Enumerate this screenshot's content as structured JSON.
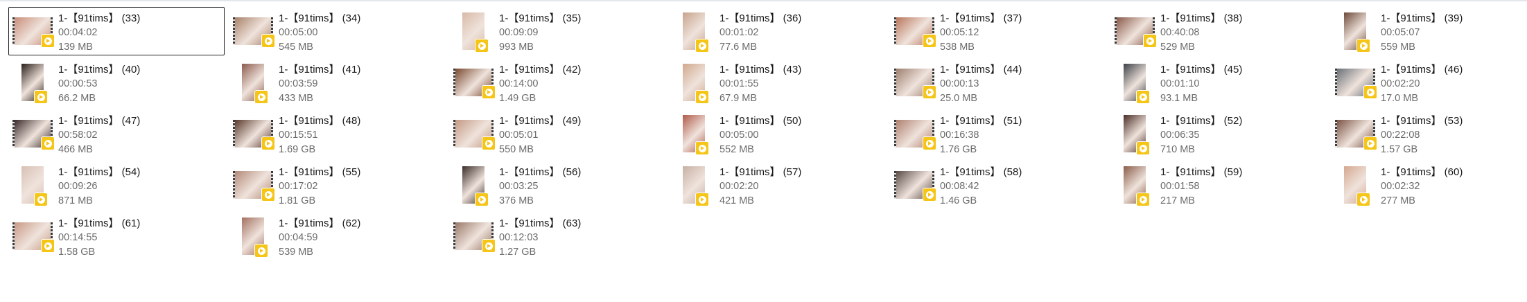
{
  "files": [
    {
      "name": "1-【91tims】 (33)",
      "duration": "00:04:02",
      "size": "139 MB",
      "orientation": "landscape",
      "selected": true,
      "tone": "#c98e7a"
    },
    {
      "name": "1-【91tims】 (34)",
      "duration": "00:05:00",
      "size": "545 MB",
      "orientation": "landscape",
      "selected": false,
      "tone": "#a9826a"
    },
    {
      "name": "1-【91tims】 (35)",
      "duration": "00:09:09",
      "size": "993 MB",
      "orientation": "portrait",
      "selected": false,
      "tone": "#d9b9a6"
    },
    {
      "name": "1-【91tims】 (36)",
      "duration": "00:01:02",
      "size": "77.6 MB",
      "orientation": "portrait",
      "selected": false,
      "tone": "#c7a38c"
    },
    {
      "name": "1-【91tims】 (37)",
      "duration": "00:05:12",
      "size": "538 MB",
      "orientation": "landscape",
      "selected": false,
      "tone": "#b9765c"
    },
    {
      "name": "1-【91tims】 (38)",
      "duration": "00:40:08",
      "size": "529 MB",
      "orientation": "landscape",
      "selected": false,
      "tone": "#8a5a4a"
    },
    {
      "name": "1-【91tims】 (39)",
      "duration": "00:05:07",
      "size": "559 MB",
      "orientation": "portrait",
      "selected": false,
      "tone": "#6e4a3a"
    },
    {
      "name": "1-【91tims】 (40)",
      "duration": "00:00:53",
      "size": "66.2 MB",
      "orientation": "portrait",
      "selected": false,
      "tone": "#2a1e18"
    },
    {
      "name": "1-【91tims】 (41)",
      "duration": "00:03:59",
      "size": "433 MB",
      "orientation": "portrait",
      "selected": false,
      "tone": "#8c5a4c"
    },
    {
      "name": "1-【91tims】 (42)",
      "duration": "00:14:00",
      "size": "1.49 GB",
      "orientation": "landscape",
      "selected": false,
      "tone": "#7a4a30"
    },
    {
      "name": "1-【91tims】 (43)",
      "duration": "00:01:55",
      "size": "67.9 MB",
      "orientation": "portrait",
      "selected": false,
      "tone": "#d0a88e"
    },
    {
      "name": "1-【91tims】 (44)",
      "duration": "00:00:13",
      "size": "25.0 MB",
      "orientation": "landscape",
      "selected": false,
      "tone": "#9e8070"
    },
    {
      "name": "1-【91tims】 (45)",
      "duration": "00:01:10",
      "size": "93.1 MB",
      "orientation": "portrait",
      "selected": false,
      "tone": "#3c4048"
    },
    {
      "name": "1-【91tims】 (46)",
      "duration": "00:02:20",
      "size": "17.0 MB",
      "orientation": "landscape",
      "selected": false,
      "tone": "#6a7078"
    },
    {
      "name": "1-【91tims】 (47)",
      "duration": "00:58:02",
      "size": "466 MB",
      "orientation": "landscape",
      "selected": false,
      "tone": "#3a2a2a"
    },
    {
      "name": "1-【91tims】 (48)",
      "duration": "00:15:51",
      "size": "1.69 GB",
      "orientation": "landscape",
      "selected": false,
      "tone": "#5a3a2c"
    },
    {
      "name": "1-【91tims】 (49)",
      "duration": "00:05:01",
      "size": "550 MB",
      "orientation": "landscape",
      "selected": false,
      "tone": "#c49a84"
    },
    {
      "name": "1-【91tims】 (50)",
      "duration": "00:05:00",
      "size": "552 MB",
      "orientation": "portrait",
      "selected": false,
      "tone": "#b05a4a"
    },
    {
      "name": "1-【91tims】 (51)",
      "duration": "00:16:38",
      "size": "1.76 GB",
      "orientation": "landscape",
      "selected": false,
      "tone": "#b08070"
    },
    {
      "name": "1-【91tims】 (52)",
      "duration": "00:06:35",
      "size": "710 MB",
      "orientation": "portrait",
      "selected": false,
      "tone": "#4a2e26"
    },
    {
      "name": "1-【91tims】 (53)",
      "duration": "00:22:08",
      "size": "1.57 GB",
      "orientation": "landscape",
      "selected": false,
      "tone": "#7c5446"
    },
    {
      "name": "1-【91tims】 (54)",
      "duration": "00:09:26",
      "size": "871 MB",
      "orientation": "portrait",
      "selected": false,
      "tone": "#d8c0b4"
    },
    {
      "name": "1-【91tims】 (55)",
      "duration": "00:17:02",
      "size": "1.81 GB",
      "orientation": "landscape",
      "selected": false,
      "tone": "#b48a78"
    },
    {
      "name": "1-【91tims】 (56)",
      "duration": "00:03:25",
      "size": "376 MB",
      "orientation": "portrait",
      "selected": false,
      "tone": "#3a2c28"
    },
    {
      "name": "1-【91tims】 (57)",
      "duration": "00:02:20",
      "size": "421 MB",
      "orientation": "portrait",
      "selected": false,
      "tone": "#c8b0a4"
    },
    {
      "name": "1-【91tims】 (58)",
      "duration": "00:08:42",
      "size": "1.46 GB",
      "orientation": "landscape",
      "selected": false,
      "tone": "#5a4a46"
    },
    {
      "name": "1-【91tims】 (59)",
      "duration": "00:01:58",
      "size": "217 MB",
      "orientation": "portrait",
      "selected": false,
      "tone": "#8a5c48"
    },
    {
      "name": "1-【91tims】 (60)",
      "duration": "00:02:32",
      "size": "277 MB",
      "orientation": "portrait",
      "selected": false,
      "tone": "#d4a890"
    },
    {
      "name": "1-【91tims】 (61)",
      "duration": "00:14:55",
      "size": "1.58 GB",
      "orientation": "landscape",
      "selected": false,
      "tone": "#c89a86"
    },
    {
      "name": "1-【91tims】 (62)",
      "duration": "00:04:59",
      "size": "539 MB",
      "orientation": "portrait",
      "selected": false,
      "tone": "#a47060"
    },
    {
      "name": "1-【91tims】 (63)",
      "duration": "00:12:03",
      "size": "1.27 GB",
      "orientation": "landscape",
      "selected": false,
      "tone": "#9a7a6a"
    }
  ],
  "colors": {
    "play_badge": "#f5c518",
    "selection_border": "#1f1f1f"
  },
  "icons": {
    "play": "play-badge-icon",
    "film": "film-strip-icon"
  }
}
